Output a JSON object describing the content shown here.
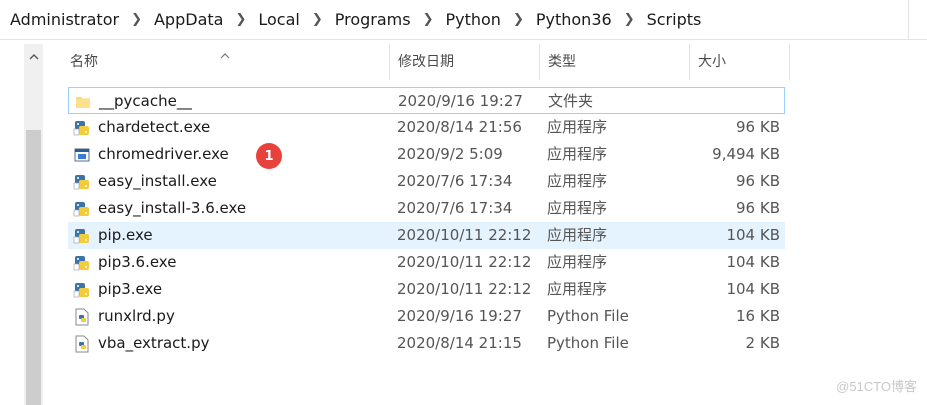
{
  "breadcrumb": [
    "Administrator",
    "AppData",
    "Local",
    "Programs",
    "Python",
    "Python36",
    "Scripts"
  ],
  "columns": {
    "name": "名称",
    "date": "修改日期",
    "type": "类型",
    "size": "大小"
  },
  "files": [
    {
      "name": "__pycache__",
      "date": "2020/9/16 19:27",
      "type": "文件夹",
      "size": "",
      "icon": "folder-icon"
    },
    {
      "name": "chardetect.exe",
      "date": "2020/8/14 21:56",
      "type": "应用程序",
      "size": "96 KB",
      "icon": "python-exe-icon"
    },
    {
      "name": "chromedriver.exe",
      "date": "2020/9/2 5:09",
      "type": "应用程序",
      "size": "9,494 KB",
      "icon": "app-window-icon"
    },
    {
      "name": "easy_install.exe",
      "date": "2020/7/6 17:34",
      "type": "应用程序",
      "size": "96 KB",
      "icon": "python-exe-icon"
    },
    {
      "name": "easy_install-3.6.exe",
      "date": "2020/7/6 17:34",
      "type": "应用程序",
      "size": "96 KB",
      "icon": "python-exe-icon"
    },
    {
      "name": "pip.exe",
      "date": "2020/10/11 22:12",
      "type": "应用程序",
      "size": "104 KB",
      "icon": "python-exe-icon"
    },
    {
      "name": "pip3.6.exe",
      "date": "2020/10/11 22:12",
      "type": "应用程序",
      "size": "104 KB",
      "icon": "python-exe-icon"
    },
    {
      "name": "pip3.exe",
      "date": "2020/10/11 22:12",
      "type": "应用程序",
      "size": "104 KB",
      "icon": "python-exe-icon"
    },
    {
      "name": "runxlrd.py",
      "date": "2020/9/16 19:27",
      "type": "Python File",
      "size": "16 KB",
      "icon": "python-file-icon"
    },
    {
      "name": "vba_extract.py",
      "date": "2020/8/14 21:15",
      "type": "Python File",
      "size": "2 KB",
      "icon": "python-file-icon"
    }
  ],
  "annotation_badge": "1",
  "watermark": "@51CTO博客",
  "colors": {
    "selection_border": "#99d1ff",
    "hover_bg": "#e5f3ff",
    "badge": "#e8423c"
  }
}
